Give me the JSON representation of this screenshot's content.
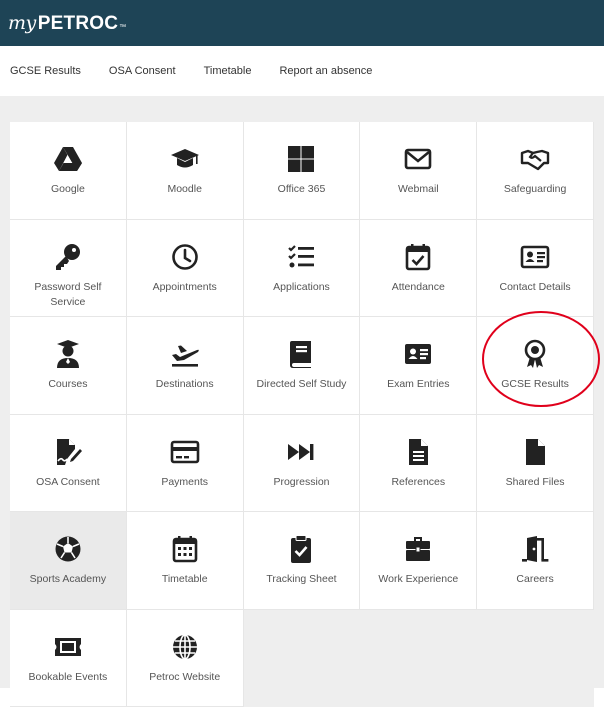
{
  "header": {
    "brand_my": "my",
    "brand_name": "PETROC",
    "brand_tm": "™"
  },
  "nav": {
    "items": [
      "GCSE Results",
      "OSA Consent",
      "Timetable",
      "Report an absence"
    ]
  },
  "tiles": [
    {
      "label": "Google",
      "icon": "google-drive-icon"
    },
    {
      "label": "Moodle",
      "icon": "graduation-cap-icon"
    },
    {
      "label": "Office 365",
      "icon": "windows-icon"
    },
    {
      "label": "Webmail",
      "icon": "envelope-icon"
    },
    {
      "label": "Safeguarding",
      "icon": "handshake-icon"
    },
    {
      "label": "Password Self Service",
      "icon": "key-icon"
    },
    {
      "label": "Appointments",
      "icon": "clock-icon"
    },
    {
      "label": "Applications",
      "icon": "checklist-icon"
    },
    {
      "label": "Attendance",
      "icon": "calendar-check-icon"
    },
    {
      "label": "Contact Details",
      "icon": "id-card-icon"
    },
    {
      "label": "Courses",
      "icon": "student-icon"
    },
    {
      "label": "Destinations",
      "icon": "plane-departure-icon"
    },
    {
      "label": "Directed Self Study",
      "icon": "book-icon"
    },
    {
      "label": "Exam Entries",
      "icon": "id-badge-icon"
    },
    {
      "label": "GCSE Results",
      "icon": "award-ribbon-icon"
    },
    {
      "label": "OSA Consent",
      "icon": "signature-icon"
    },
    {
      "label": "Payments",
      "icon": "credit-card-icon"
    },
    {
      "label": "Progression",
      "icon": "fast-forward-icon"
    },
    {
      "label": "References",
      "icon": "document-icon"
    },
    {
      "label": "Shared Files",
      "icon": "file-icon"
    },
    {
      "label": "Sports Academy",
      "icon": "football-icon"
    },
    {
      "label": "Timetable",
      "icon": "calendar-icon"
    },
    {
      "label": "Tracking Sheet",
      "icon": "clipboard-check-icon"
    },
    {
      "label": "Work Experience",
      "icon": "briefcase-icon"
    },
    {
      "label": "Careers",
      "icon": "door-open-icon"
    },
    {
      "label": "Bookable Events",
      "icon": "ticket-icon"
    },
    {
      "label": "Petroc Website",
      "icon": "globe-icon"
    }
  ],
  "colors": {
    "header_bg": "#1e4456",
    "highlight": "#e0001b",
    "icon": "#222222"
  }
}
